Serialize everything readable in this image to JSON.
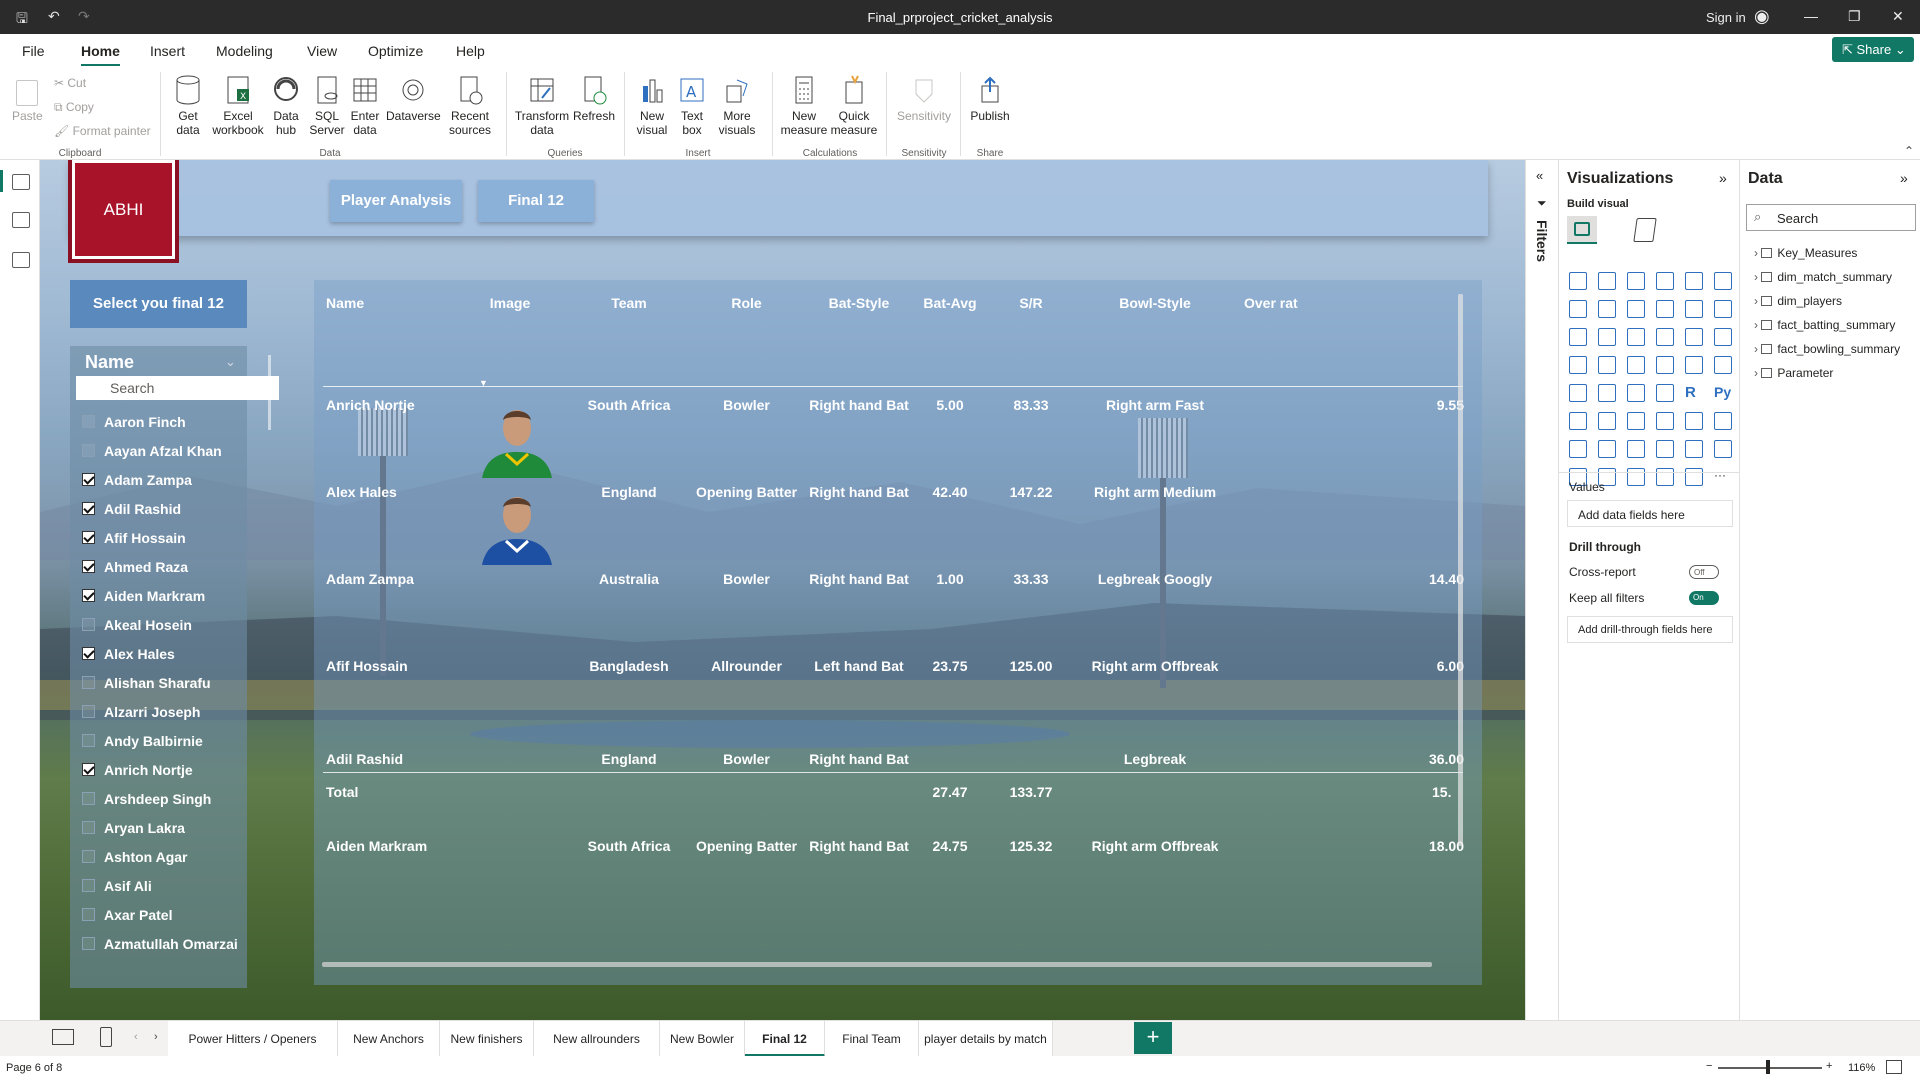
{
  "window": {
    "title": "Final_prproject_cricket_analysis",
    "sign_in": "Sign in",
    "share": "Share"
  },
  "menu": [
    "File",
    "Home",
    "Insert",
    "Modeling",
    "View",
    "Optimize",
    "Help"
  ],
  "ribbon": {
    "clipboard": {
      "paste": "Paste",
      "cut": "Cut",
      "copy": "Copy",
      "format_painter": "Format painter",
      "group": "Clipboard"
    },
    "data": {
      "get_data": "Get data",
      "excel": "Excel workbook",
      "data_hub": "Data hub",
      "sql": "SQL Server",
      "enter": "Enter data",
      "dataverse": "Dataverse",
      "recent": "Recent sources",
      "group": "Data"
    },
    "queries": {
      "transform": "Transform data",
      "refresh": "Refresh",
      "group": "Queries"
    },
    "insert": {
      "new_visual": "New visual",
      "text_box": "Text box",
      "more_visuals": "More visuals",
      "group": "Insert"
    },
    "calculations": {
      "new_measure": "New measure",
      "quick_measure": "Quick measure",
      "group": "Calculations"
    },
    "sensitivity": {
      "label": "Sensitivity",
      "group": "Sensitivity"
    },
    "share": {
      "publish": "Publish",
      "group": "Share"
    }
  },
  "report": {
    "logo_text": "ABHI",
    "nav_buttons": [
      "Player Analysis",
      "Final 12"
    ],
    "select_button": "Select you final 12",
    "slicer": {
      "title": "Name",
      "search_placeholder": "Search",
      "items": [
        {
          "name": "Aaron Finch",
          "checked": false
        },
        {
          "name": "Aayan Afzal Khan",
          "checked": false
        },
        {
          "name": "Adam Zampa",
          "checked": true
        },
        {
          "name": "Adil Rashid",
          "checked": true
        },
        {
          "name": "Afif Hossain",
          "checked": true
        },
        {
          "name": "Ahmed Raza",
          "checked": true
        },
        {
          "name": "Aiden Markram",
          "checked": true
        },
        {
          "name": "Akeal Hosein",
          "checked": false
        },
        {
          "name": "Alex Hales",
          "checked": true
        },
        {
          "name": "Alishan Sharafu",
          "checked": false
        },
        {
          "name": "Alzarri Joseph",
          "checked": false
        },
        {
          "name": "Andy Balbirnie",
          "checked": false
        },
        {
          "name": "Anrich Nortje",
          "checked": true
        },
        {
          "name": "Arshdeep Singh",
          "checked": false
        },
        {
          "name": "Aryan Lakra",
          "checked": false
        },
        {
          "name": "Ashton Agar",
          "checked": false
        },
        {
          "name": "Asif Ali",
          "checked": false
        },
        {
          "name": "Axar Patel",
          "checked": false
        },
        {
          "name": "Azmatullah Omarzai",
          "checked": false
        }
      ]
    },
    "table": {
      "columns": [
        "Name",
        "Image",
        "Team",
        "Role",
        "Bat-Style",
        "Bat-Avg",
        "S/R",
        "Bowl-Style",
        "Over rat"
      ],
      "rows": [
        {
          "name": "Anrich Nortje",
          "team": "South Africa",
          "role": "Bowler",
          "bat_style": "Right hand Bat",
          "bat_avg": "5.00",
          "sr": "83.33",
          "bowl_style": "Right arm Fast",
          "over_rate": "9.55",
          "image": true
        },
        {
          "name": "Alex Hales",
          "team": "England",
          "role": "Opening Batter",
          "bat_style": "Right hand Bat",
          "bat_avg": "42.40",
          "sr": "147.22",
          "bowl_style": "Right arm Medium",
          "over_rate": "",
          "image": true
        },
        {
          "name": "Adam Zampa",
          "team": "Australia",
          "role": "Bowler",
          "bat_style": "Right hand Bat",
          "bat_avg": "1.00",
          "sr": "33.33",
          "bowl_style": "Legbreak Googly",
          "over_rate": "14.40",
          "image": false
        },
        {
          "name": "Afif Hossain",
          "team": "Bangladesh",
          "role": "Allrounder",
          "bat_style": "Left hand Bat",
          "bat_avg": "23.75",
          "sr": "125.00",
          "bowl_style": "Right arm Offbreak",
          "over_rate": "6.00",
          "image": false
        },
        {
          "name": "Adil Rashid",
          "team": "England",
          "role": "Bowler",
          "bat_style": "Right hand Bat",
          "bat_avg": "",
          "sr": "",
          "bowl_style": "Legbreak",
          "over_rate": "36.00",
          "image": false
        },
        {
          "name": "Aiden Markram",
          "team": "South Africa",
          "role": "Opening Batter",
          "bat_style": "Right hand Bat",
          "bat_avg": "24.75",
          "sr": "125.32",
          "bowl_style": "Right arm Offbreak",
          "over_rate": "18.00",
          "image": false
        }
      ],
      "total": {
        "label": "Total",
        "bat_avg": "27.47",
        "sr": "133.77",
        "over_rate": "15."
      }
    }
  },
  "filters": {
    "label": "Filters"
  },
  "visualizations": {
    "title": "Visualizations",
    "build_visual": "Build visual",
    "values": "Values",
    "add_data": "Add data fields here",
    "drill_through": "Drill through",
    "cross_report": "Cross-report",
    "cross_report_state": "Off",
    "keep_filters": "Keep all filters",
    "keep_filters_state": "On",
    "add_drill": "Add drill-through fields here",
    "r_label": "R",
    "py_label": "Py",
    "more": "···"
  },
  "data_pane": {
    "title": "Data",
    "search_placeholder": "Search",
    "tables": [
      "Key_Measures",
      "dim_match_summary",
      "dim_players",
      "fact_batting_summary",
      "fact_bowling_summary",
      "Parameter"
    ]
  },
  "page_tabs": [
    "Power Hitters / Openers",
    "New Anchors",
    "New finishers",
    "New allrounders",
    "New Bowler",
    "Final 12",
    "Final Team",
    "player details by match"
  ],
  "active_tab": "Final 12",
  "status": {
    "page": "Page 6 of 8",
    "zoom": "116%"
  },
  "colors": {
    "accent": "#117865",
    "logo": "#a8132a",
    "nav_button": "#8cb1d8",
    "select_button": "#5a89bd"
  }
}
